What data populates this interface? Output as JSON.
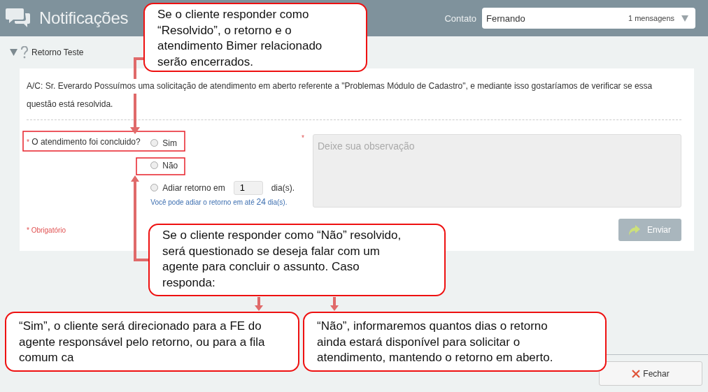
{
  "header": {
    "title": "Notificações",
    "contact_label": "Contato",
    "contact": {
      "value": "Fernando",
      "count": "1 mensagens"
    }
  },
  "section": {
    "title": "Retorno Teste",
    "expanded": true
  },
  "message": "A/C: Sr. Everardo Possuímos uma solicitação de atendimento em aberto referente a \"Problemas Módulo de Cadastro\", e mediante isso gostaríamos de verificar se essa questão está resolvida.",
  "question": {
    "required_mark": "*",
    "label": "O atendimento foi concluido?"
  },
  "options": [
    {
      "kind": "radio",
      "label": "Sim",
      "selected": false
    },
    {
      "kind": "radio",
      "label": "Não",
      "selected": false
    },
    {
      "kind": "postpone",
      "label": "Adiar retorno em",
      "value": "1",
      "unit": "dia(s).",
      "selected": false
    }
  ],
  "hint": "Você pode adiar o retorno em até **24** dia(s).",
  "observation": {
    "required_mark": "*",
    "placeholder": "Deixe sua observação"
  },
  "required_note": "* Obrigatório",
  "send_button": {
    "label": "Enviar",
    "disabled": true
  },
  "close_button": {
    "label": "Fechar"
  },
  "annotations": [
    {
      "text": "Se o cliente responder como “Resolvido”, o retorno e o atendimento Bimer relacionado serão encerrados."
    },
    {
      "text": "Se o cliente responder como “Não” resolvido, será questionado se deseja falar com um agente para concluir o assunto. Caso responda:"
    },
    {
      "text": "“Sim”, o cliente será direcionado para a FE do agente responsável pelo retorno, ou para a fila comum ca"
    },
    {
      "text": "“Não”, informaremos quantos dias o retorno ainda estará disponível para solicitar o atendimento, mantendo o retorno em aberto."
    }
  ]
}
